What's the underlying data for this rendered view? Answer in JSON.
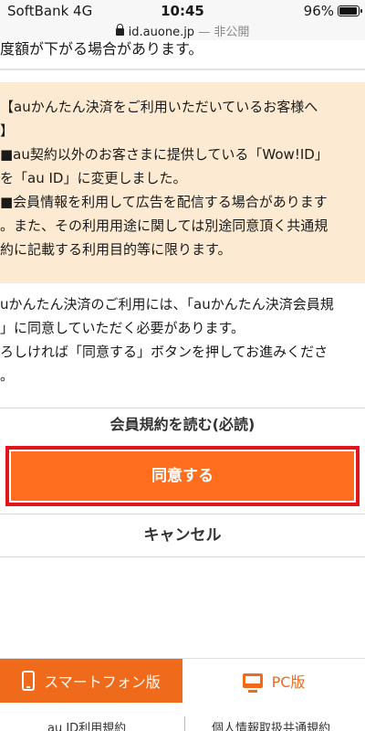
{
  "status_bar": {
    "carrier": "SoftBank  4G",
    "time": "10:45",
    "battery": "96%"
  },
  "url_bar": {
    "domain": "id.auone.jp",
    "suffix": " — 非公開"
  },
  "notice": {
    "top_line": "度額が下がる場合があります。"
  },
  "info_box": {
    "lines": [
      "【auかんたん決済をご利用いただいているお客様へ",
      "】",
      "■au契約以外のお客さまに提供している「Wow!ID」",
      "を「au ID」に変更しました。",
      "■会員情報を利用して広告を配信する場合があります",
      "。また、その利用用途に関しては別途同意頂く共通規",
      "約に記載する利用目的等に限ります。"
    ]
  },
  "consent": {
    "lines": [
      "uかんたん決済のご利用には、「auかんたん決済会員規",
      "」に同意していただく必要があります。",
      "ろしければ「同意する」ボタンを押してお進みくださ",
      "。"
    ]
  },
  "actions": {
    "read_terms": "会員規約を読む(必読)",
    "agree": "同意する",
    "cancel": "キャンセル"
  },
  "footer": {
    "tab_smartphone": "スマートフォン版",
    "tab_pc": "PC版",
    "link_terms": "au ID利用規約",
    "link_privacy": "個人情報取扱共通規約"
  },
  "colors": {
    "accent": "#ff6e1f",
    "highlight": "#e0161f",
    "notice_bg": "#fcebd2"
  }
}
